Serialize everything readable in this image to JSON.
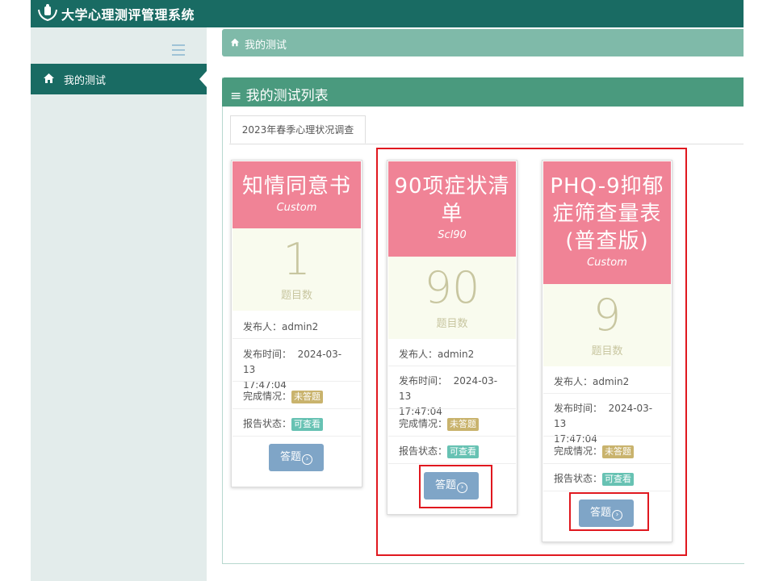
{
  "app": {
    "title": "大学心理测评管理系统"
  },
  "sidebar": {
    "items": [
      {
        "label": "我的测试",
        "icon": "home-icon"
      }
    ]
  },
  "breadcrumb": {
    "label": "我的测试",
    "icon": "home-icon"
  },
  "panel": {
    "title": "≡ 我的测试列表",
    "tab": "2023年春季心理状况调查"
  },
  "cards": [
    {
      "name": "知情同意书",
      "type": "Custom",
      "count": "1",
      "count_label": "题目数",
      "publisher_label": "发布人：",
      "publisher": "admin2",
      "time_label": "发布时间：",
      "time_date": "2024-03-13",
      "time_clock": "17:47:04",
      "status_label": "完成情况：",
      "status": "未答题",
      "report_label": "报告状态：",
      "report": "可查看",
      "button": "答题"
    },
    {
      "name": "90项症状清单",
      "type": "Scl90",
      "count": "90",
      "count_label": "题目数",
      "publisher_label": "发布人：",
      "publisher": "admin2",
      "time_label": "发布时间：",
      "time_date": "2024-03-13",
      "time_clock": "17:47:04",
      "status_label": "完成情况：",
      "status": "未答题",
      "report_label": "报告状态：",
      "report": "可查看",
      "button": "答题"
    },
    {
      "name": "PHQ-9抑郁症筛查量表(普查版)",
      "type": "Custom",
      "count": "9",
      "count_label": "题目数",
      "publisher_label": "发布人：",
      "publisher": "admin2",
      "time_label": "发布时间：",
      "time_date": "2024-03-13",
      "time_clock": "17:47:04",
      "status_label": "完成情况：",
      "status": "未答题",
      "report_label": "报告状态：",
      "report": "可查看",
      "button": "答题"
    }
  ],
  "colors": {
    "header": "#196b63",
    "card_head": "#f08396",
    "highlight": "#e0181f"
  }
}
